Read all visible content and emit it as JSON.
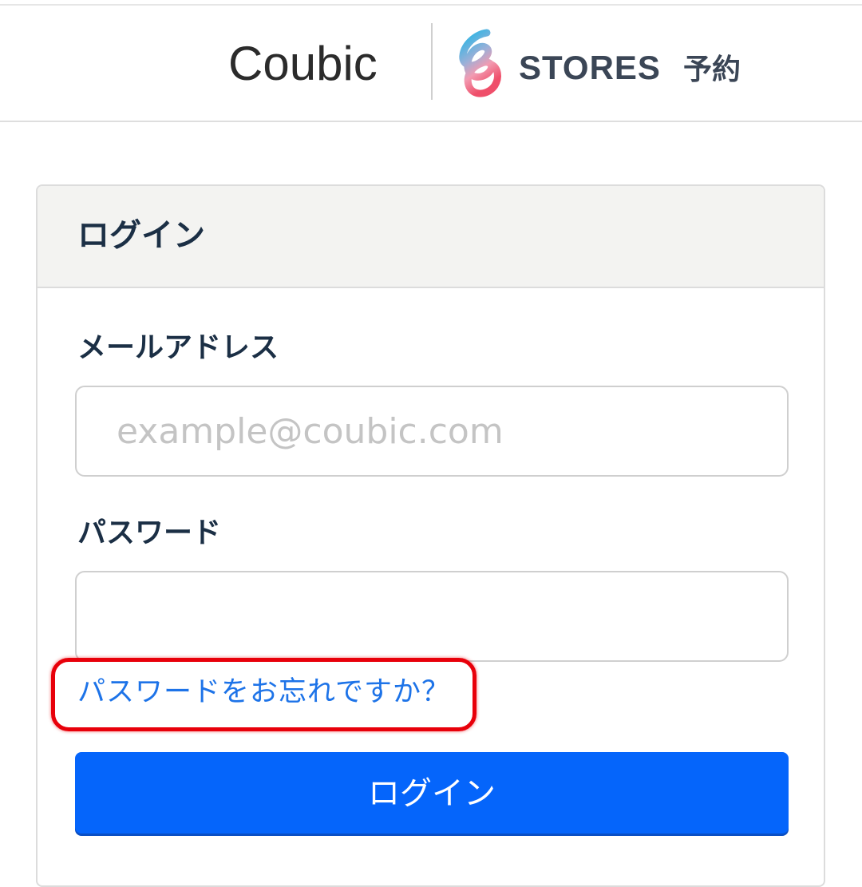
{
  "header": {
    "brand_primary": "Coubic",
    "brand_secondary": "STORES",
    "brand_secondary_suffix": "予約",
    "logo_icon": "stores-swirl-logo-icon"
  },
  "login_card": {
    "title": "ログイン",
    "email": {
      "label": "メールアドレス",
      "placeholder": "example@coubic.com",
      "value": ""
    },
    "password": {
      "label": "パスワード",
      "value": ""
    },
    "forgot_link": "パスワードをお忘れですか？",
    "submit_label": "ログイン"
  },
  "colors": {
    "primary_button": "#0565fb",
    "link": "#1d73e8",
    "highlight": "#e8000a",
    "heading": "#1b2f45"
  }
}
